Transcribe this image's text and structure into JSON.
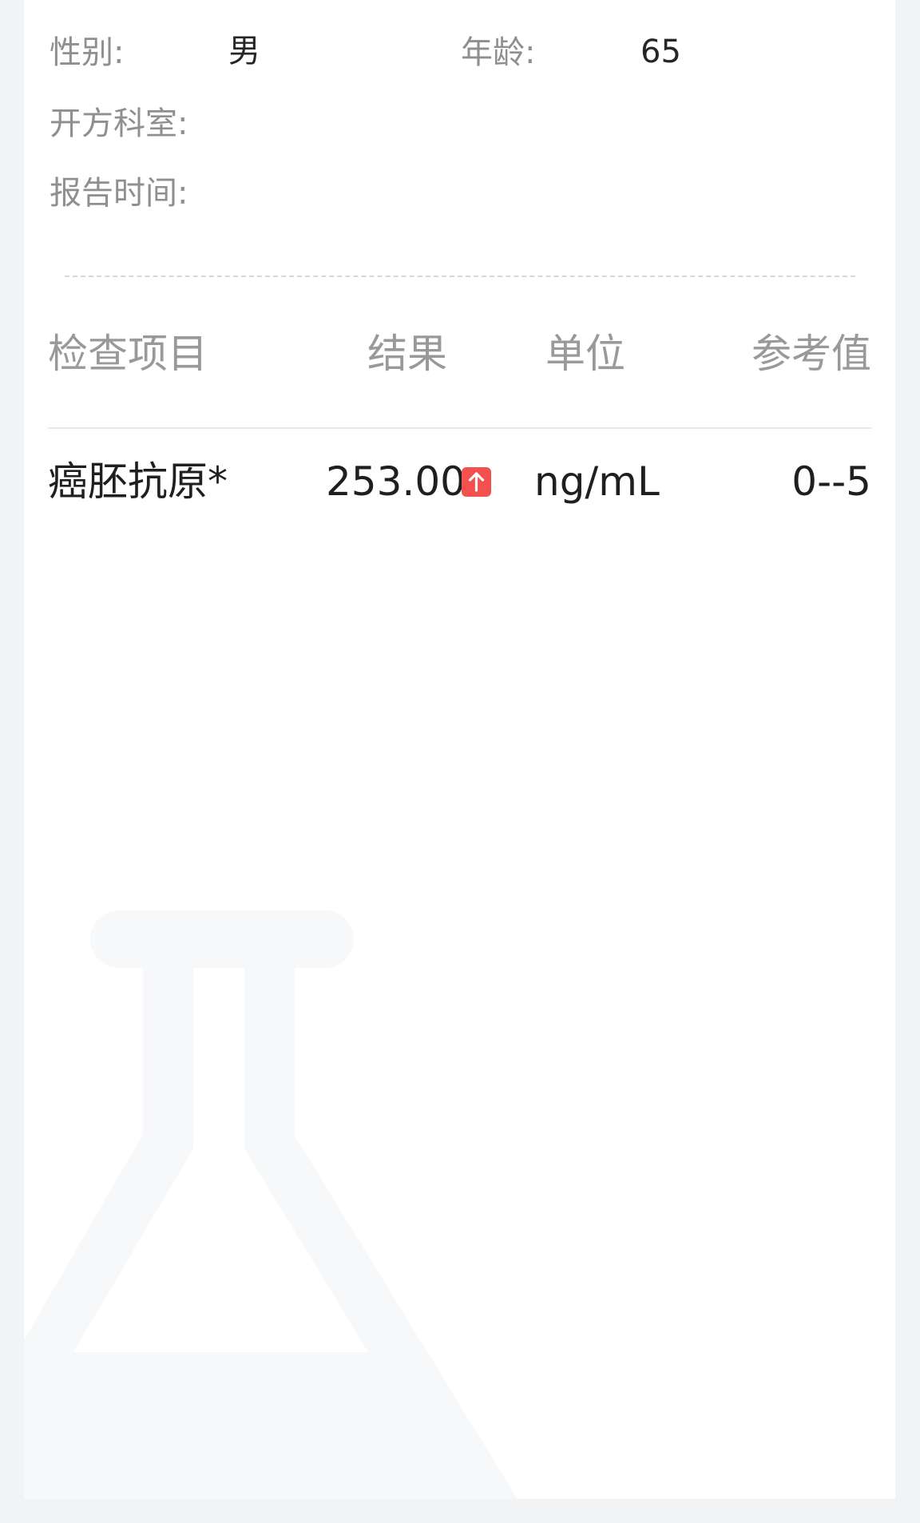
{
  "patient": {
    "gender_label": "性别:",
    "gender_value": "男",
    "age_label": "年龄:",
    "age_value": "65",
    "department_label": "开方科室:",
    "department_value": "",
    "report_time_label": "报告时间:",
    "report_time_value": ""
  },
  "table": {
    "headers": {
      "item": "检查项目",
      "result": "结果",
      "unit": "单位",
      "reference": "参考值"
    },
    "rows": [
      {
        "item": "癌胚抗原*",
        "result": "253.00",
        "flag": "high",
        "unit": "ng/mL",
        "reference": "0--5"
      }
    ]
  },
  "icons": {
    "result_flag_icon": "arrow-up-icon",
    "watermark_icon": "flask-icon"
  },
  "colors": {
    "page_background": "#f2f3f5",
    "card_background": "#ffffff",
    "label_text": "#8f8f8f",
    "value_text": "#262626",
    "high_flag": "#f2514f",
    "watermark": "#f7f8f9"
  }
}
